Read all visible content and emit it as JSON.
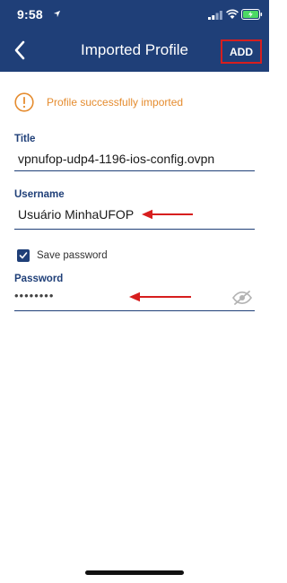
{
  "status_bar": {
    "time": "9:58"
  },
  "nav": {
    "title": "Imported Profile",
    "add_label": "ADD"
  },
  "success": {
    "message": "Profile successfully imported"
  },
  "fields": {
    "title": {
      "label": "Title",
      "value": "vpnufop-udp4-1196-ios-config.ovpn"
    },
    "username": {
      "label": "Username",
      "value": "Usuário MinhaUFOP"
    },
    "save_password": {
      "label": "Save password",
      "checked": true
    },
    "password": {
      "label": "Password",
      "masked_value": "••••••••"
    }
  },
  "colors": {
    "nav_bg": "#1f3f78",
    "accent": "#1f3f78",
    "success_orange": "#e58c2f",
    "annotation_red": "#d71e1e"
  },
  "icons": [
    "back-chevron",
    "info-circle",
    "checkmark",
    "eye-slash",
    "arrow-left"
  ]
}
